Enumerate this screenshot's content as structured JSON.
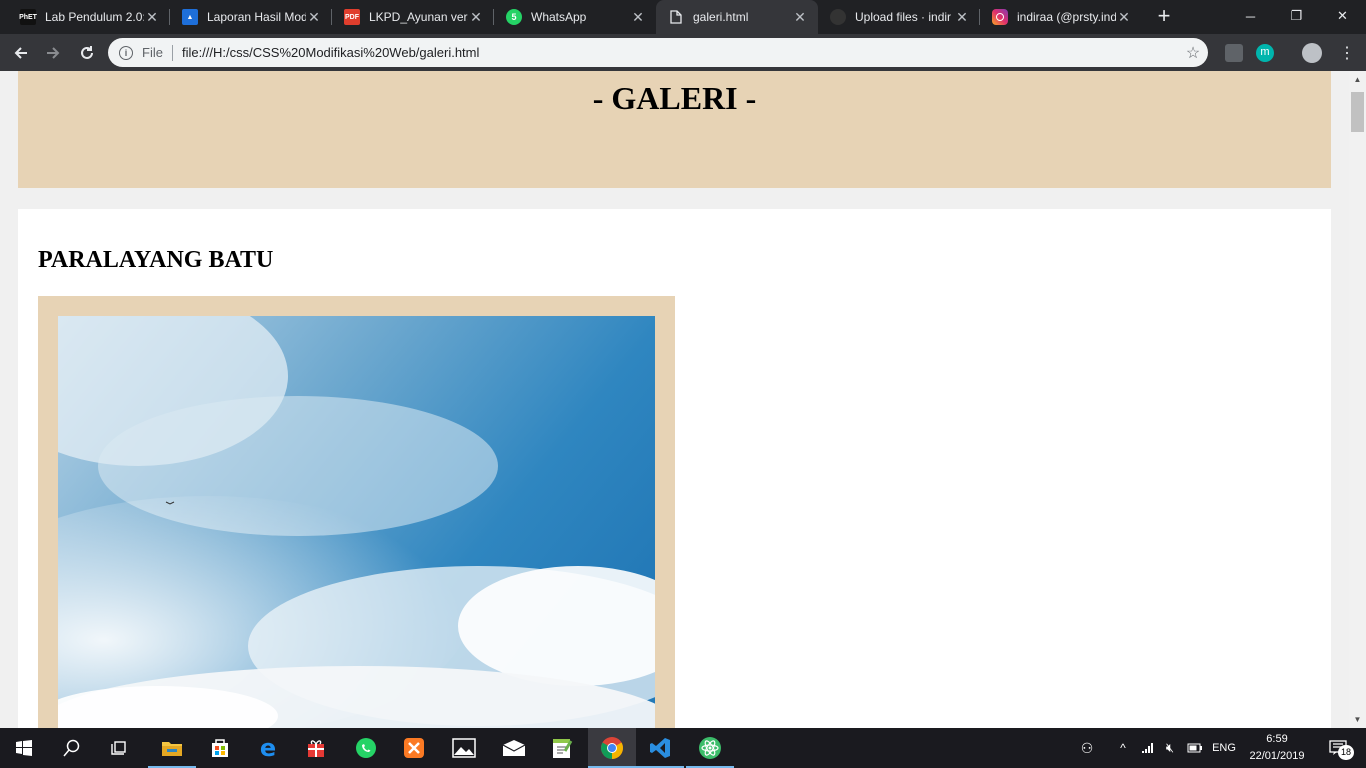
{
  "browser": {
    "tabs": [
      {
        "title": "Lab Pendulum 2.0:",
        "favicon": "phet-icon",
        "color": "#1a1a1a",
        "active": false
      },
      {
        "title": "Laporan Hasil Mod",
        "favicon": "classroom-icon",
        "color": "#1e6fd9",
        "active": false
      },
      {
        "title": "LKPD_Ayunan vers",
        "favicon": "pdf-icon",
        "color": "#e03e2d",
        "active": false
      },
      {
        "title": "WhatsApp",
        "favicon": "whatsapp-icon",
        "color": "#25d366",
        "active": false
      },
      {
        "title": "galeri.html",
        "favicon": "file-icon",
        "color": "#35363a",
        "active": true
      },
      {
        "title": "Upload files · indir",
        "favicon": "github-icon",
        "color": "#1a1a1a",
        "active": false
      },
      {
        "title": "indiraa (@prsty.ind",
        "favicon": "instagram-icon",
        "color": "#d6249f",
        "active": false
      }
    ],
    "whatsapp_badge": "5",
    "address": {
      "scheme_label": "File",
      "url": "file:///H:/css/CSS%20Modifikasi%20Web/galeri.html"
    },
    "profile_letter": "m"
  },
  "page": {
    "title": "- GALERI -",
    "section_title": "PARALAYANG BATU"
  },
  "taskbar": {
    "apps": [
      "start-icon",
      "search-icon",
      "task-view-icon",
      "file-explorer-icon",
      "store-icon",
      "edge-icon",
      "gift-icon",
      "whatsapp-icon",
      "xampp-icon",
      "photos-icon",
      "mail-icon",
      "notepad-plus-icon",
      "chrome-icon",
      "vscode-icon",
      "atom-icon"
    ],
    "language": "ENG",
    "time": "6:59",
    "date": "22/01/2019",
    "notification_count": "18"
  }
}
